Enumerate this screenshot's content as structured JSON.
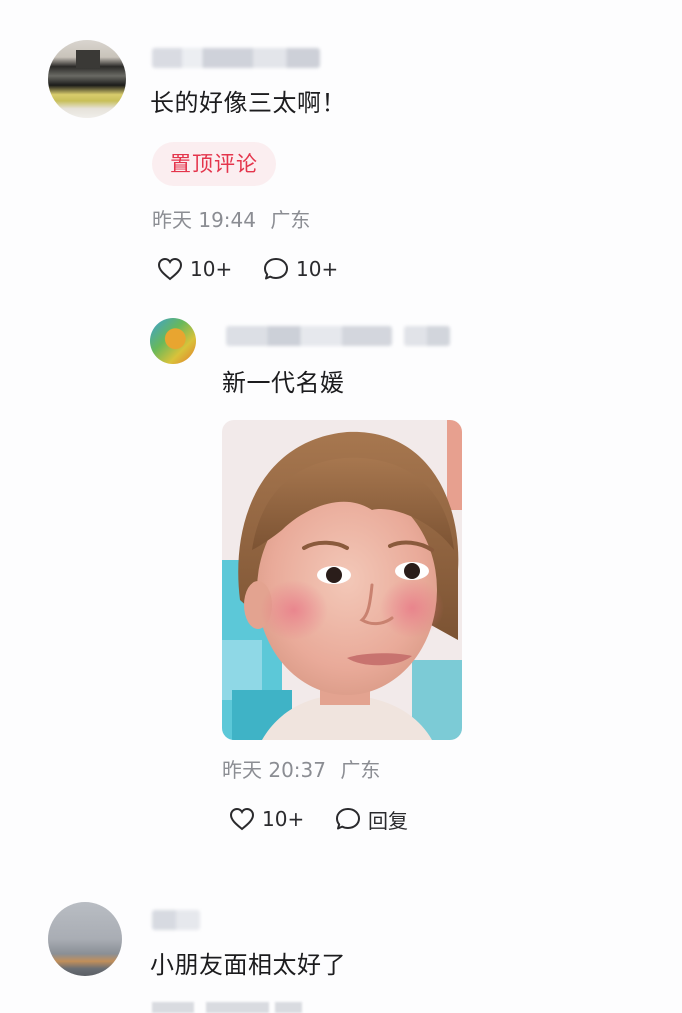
{
  "comments": [
    {
      "text": "长的好像三太啊！",
      "badge": "置顶评论",
      "time": "昨天 19:44",
      "location": "广东",
      "likes": "10+",
      "replies": "10+"
    }
  ],
  "reply": {
    "text": "新一代名媛",
    "time": "昨天 20:37",
    "location": "广东",
    "likes": "10+",
    "reply_label": "回复"
  },
  "comment_2": {
    "text": "小朋友面相太好了"
  },
  "icons": {
    "like": "heart-outline-icon",
    "comment": "speech-bubble-icon"
  },
  "colors": {
    "badge_text": "#e4354c",
    "badge_bg": "#fbeef0",
    "meta_text": "#8b8d93"
  }
}
